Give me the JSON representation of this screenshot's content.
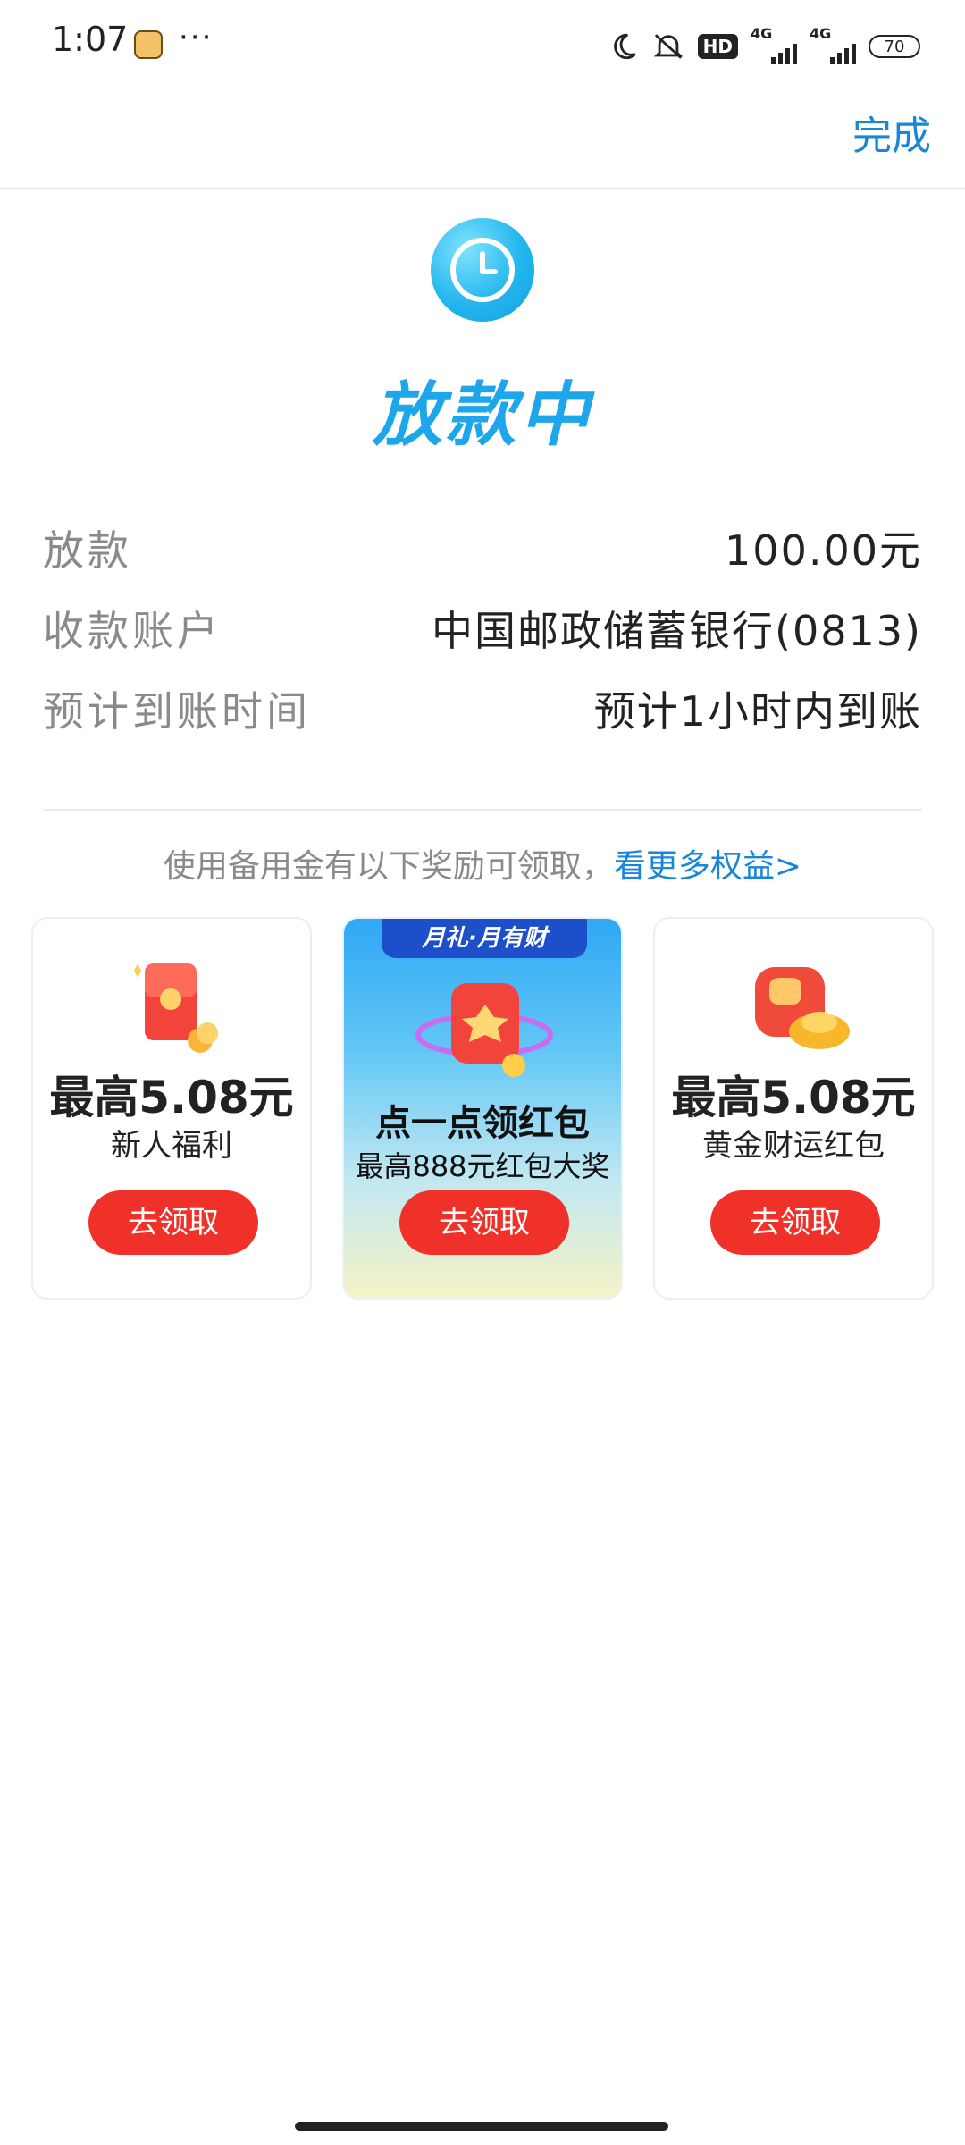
{
  "status_bar": {
    "time": "1:07",
    "more": "···",
    "hd": "HD",
    "network1": "4G",
    "network2": "4G",
    "battery": "70"
  },
  "header": {
    "done_label": "完成"
  },
  "status": {
    "title": "放款中",
    "icon": "clock-icon"
  },
  "details": [
    {
      "label": "放款",
      "value": "100.00元"
    },
    {
      "label": "收款账户",
      "value": "中国邮政储蓄银行(0813)"
    },
    {
      "label": "预计到账时间",
      "value": "预计1小时内到账"
    }
  ],
  "promo": {
    "text": "使用备用金有以下奖励可领取，",
    "link": "看更多权益>"
  },
  "cards": [
    {
      "amount": "最高5.08元",
      "desc": "新人福利",
      "button": "去领取",
      "icon": "red-envelope-coins-icon"
    },
    {
      "banner": "月礼·月有财",
      "title": "点一点领红包",
      "subtitle": "最高888元红包大奖",
      "button": "去领取",
      "icon": "red-envelope-planet-icon"
    },
    {
      "amount": "最高5.08元",
      "desc": "黄金财运红包",
      "button": "去领取",
      "icon": "red-envelope-gold-ingot-icon"
    }
  ],
  "colors": {
    "accent": "#1a86d8",
    "title": "#1da7ea",
    "button": "#f0312a"
  }
}
